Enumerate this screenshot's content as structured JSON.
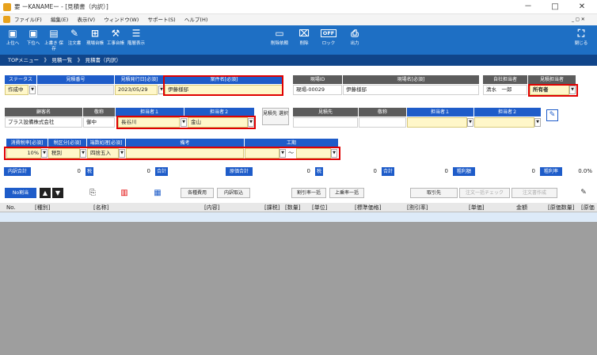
{
  "window": {
    "title": "要 ーKANAMEー - [見積書（内訳）]",
    "minimize": "－",
    "maximize": "□",
    "close": "✕",
    "sub": "_ ◻ ✕"
  },
  "menu": [
    "ファイル(F)",
    "編集(E)",
    "表示(V)",
    "ウィンドウ(W)",
    "サポート(S)",
    "ヘルプ(H)"
  ],
  "toolbar": {
    "items": [
      "上位へ",
      "下位へ",
      "上書き 保存",
      "注文書",
      "現場台帳",
      "工事台帳",
      "階層表示"
    ],
    "right": [
      "削除依頼",
      "削除",
      "ロック",
      "出力"
    ],
    "close": "閉じる",
    "off": "OFF"
  },
  "breadcrumb": "TOPメニュー　》　見積一覧　》　見積書（内訳）",
  "headers": {
    "status": "ステータス",
    "est_no": "見積番号",
    "issue_date": "見積発行日[必須]",
    "project_name": "案件名[必須]",
    "site_id": "現場ID",
    "site_name": "現場名[必須]",
    "own_person": "自社担当者",
    "est_person": "見積担当者",
    "customer": "顧客名",
    "honorific": "敬称",
    "person1": "担当者１",
    "person2": "担当者２",
    "destination": "見積先",
    "dest_honorific": "敬称",
    "dest_person1": "担当者１",
    "dest_person2": "担当者２",
    "tax_rate": "消費税率[必須]",
    "tax_type": "税区分[必須]",
    "rounding": "端数処理[必須]",
    "note": "備考",
    "period": "工期"
  },
  "values": {
    "status": "作成中",
    "issue_date": "2023/05/29",
    "project_name": "伊藤様邸",
    "site_id": "現場-00029",
    "site_name": "伊藤様邸",
    "own_person": "清水　一郎",
    "est_person": "所有者",
    "customer": "プラス設備株式会社",
    "honorific": "御中",
    "person1": "長谷川",
    "person2": "金山",
    "tax_rate": "10%",
    "tax_type": "税別",
    "rounding": "四捨五入",
    "period_sep": "～"
  },
  "select_dest": "見積先 選択",
  "totals": [
    {
      "label": "内訳合計",
      "value": "0",
      "tag": "税"
    },
    {
      "label": "合計",
      "value": "0"
    },
    {
      "label": "原価合計",
      "value": "0",
      "tag": "税"
    },
    {
      "label": "合計",
      "value": "0"
    },
    {
      "label": "粗利額",
      "value": "0"
    },
    {
      "label": "粗利率",
      "value": "0.0%"
    }
  ],
  "actions": {
    "no_assign": "No割当",
    "expenses": "各種費用",
    "import": "内訳取込",
    "discount_bulk": "割引率一括",
    "markup_bulk": "上乗率一括",
    "supplier": "取引先",
    "order_check": "注文一括チェック",
    "order_create": "注文書作成"
  },
  "columns": [
    "No.",
    "[種別]",
    "[名称]",
    "[内容]",
    "[課税]",
    "[数量]",
    "[単位]",
    "[標準価格]",
    "[割引率]",
    "[単価]",
    "金額",
    "[原価数量]",
    "[原価"
  ]
}
